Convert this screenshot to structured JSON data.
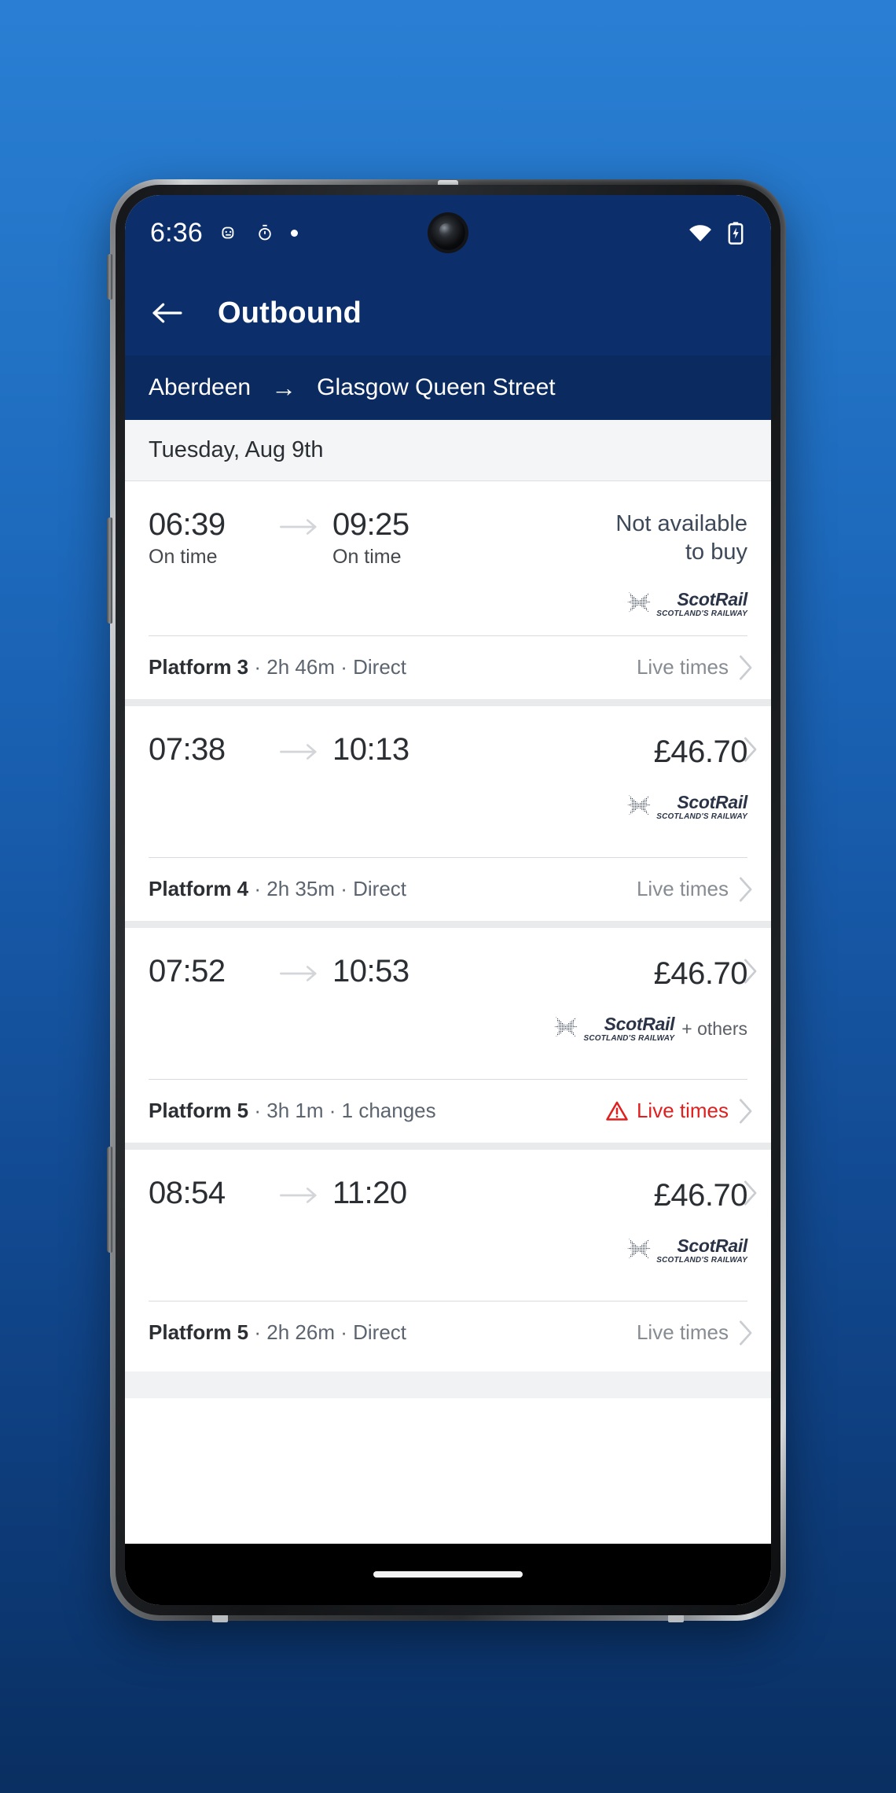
{
  "status_bar": {
    "time": "6:36",
    "icons": [
      "android-head-icon",
      "stopwatch-icon",
      "notification-dot-icon"
    ],
    "right_icons": [
      "wifi-icon",
      "battery-charging-icon"
    ]
  },
  "app_bar": {
    "back_label": "Back",
    "title": "Outbound"
  },
  "route": {
    "origin": "Aberdeen",
    "arrow": "→",
    "destination": "Glasgow Queen Street"
  },
  "date_header": {
    "label": "Tuesday, Aug 9th"
  },
  "colors": {
    "app_bar": "#0c2f6b",
    "route_bar": "#0a2a60",
    "alert": "#e01f1f",
    "card_bg": "#ffffff"
  },
  "journeys": [
    {
      "depart_time": "06:39",
      "depart_status": "On time",
      "arrive_time": "09:25",
      "arrive_status": "On time",
      "price": null,
      "unavailable_line1": "Not available",
      "unavailable_line2": "to buy",
      "operator": "ScotRail",
      "operator_tagline": "SCOTLAND'S RAILWAY",
      "operator_extra": null,
      "platform": "Platform 3",
      "duration": "2h 46m",
      "changes": "Direct",
      "live_times_label": "Live times",
      "has_alert": false,
      "has_main_chevron": false
    },
    {
      "depart_time": "07:38",
      "depart_status": null,
      "arrive_time": "10:13",
      "arrive_status": null,
      "price": "£46.70",
      "unavailable_line1": null,
      "unavailable_line2": null,
      "operator": "ScotRail",
      "operator_tagline": "SCOTLAND'S RAILWAY",
      "operator_extra": null,
      "platform": "Platform 4",
      "duration": "2h 35m",
      "changes": "Direct",
      "live_times_label": "Live times",
      "has_alert": false,
      "has_main_chevron": true
    },
    {
      "depart_time": "07:52",
      "depart_status": null,
      "arrive_time": "10:53",
      "arrive_status": null,
      "price": "£46.70",
      "unavailable_line1": null,
      "unavailable_line2": null,
      "operator": "ScotRail",
      "operator_tagline": "SCOTLAND'S RAILWAY",
      "operator_extra": "+ others",
      "platform": "Platform 5",
      "duration": "3h 1m",
      "changes": "1 changes",
      "live_times_label": "Live times",
      "has_alert": true,
      "has_main_chevron": true
    },
    {
      "depart_time": "08:54",
      "depart_status": null,
      "arrive_time": "11:20",
      "arrive_status": null,
      "price": "£46.70",
      "unavailable_line1": null,
      "unavailable_line2": null,
      "operator": "ScotRail",
      "operator_tagline": "SCOTLAND'S RAILWAY",
      "operator_extra": null,
      "platform": "Platform 5",
      "duration": "2h 26m",
      "changes": "Direct",
      "live_times_label": "Live times",
      "has_alert": false,
      "has_main_chevron": true
    }
  ]
}
